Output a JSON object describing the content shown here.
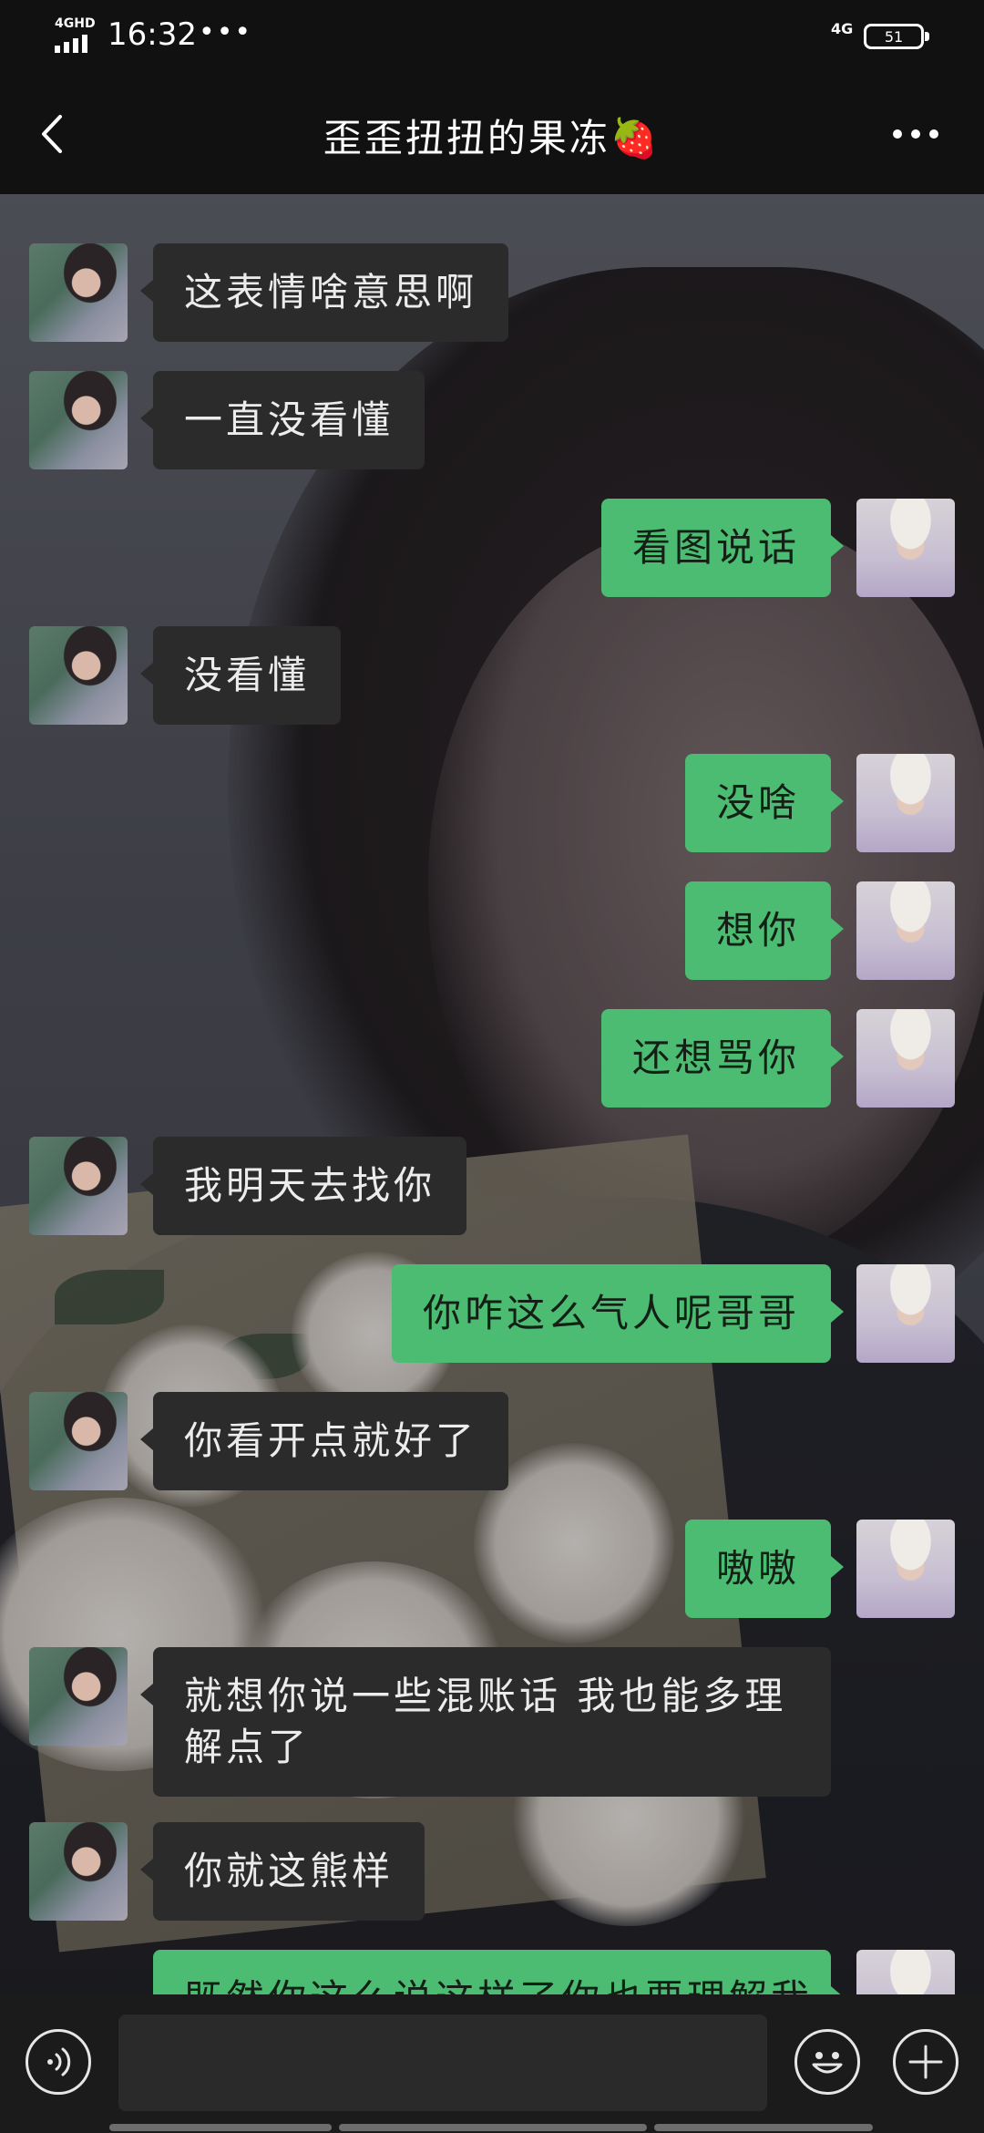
{
  "status_bar": {
    "network_label": "4GHD",
    "time": "16:32",
    "more_dots": "•••",
    "data_label": "4G",
    "battery": "51"
  },
  "header": {
    "title": "歪歪扭扭的果冻🍓"
  },
  "messages": [
    {
      "from": "them",
      "text": "这表情啥意思啊"
    },
    {
      "from": "them",
      "text": "一直没看懂"
    },
    {
      "from": "me",
      "text": "看图说话"
    },
    {
      "from": "them",
      "text": "没看懂"
    },
    {
      "from": "me",
      "text": "没啥"
    },
    {
      "from": "me",
      "text": "想你"
    },
    {
      "from": "me",
      "text": "还想骂你"
    },
    {
      "from": "them",
      "text": "我明天去找你"
    },
    {
      "from": "me",
      "text": "你咋这么气人呢哥哥"
    },
    {
      "from": "them",
      "text": "你看开点就好了"
    },
    {
      "from": "me",
      "text": "嗷嗷"
    },
    {
      "from": "them",
      "text": "就想你说一些混账话 我也能多理解点了"
    },
    {
      "from": "them",
      "text": "你就这熊样"
    },
    {
      "from": "me",
      "text": "既然你这么说这样了你也要理解我"
    }
  ],
  "input_bar": {
    "placeholder": "",
    "value": ""
  },
  "colors": {
    "my_bubble": "#4cbc72",
    "their_bubble": "#2b2b2b",
    "bar_background": "#111111"
  },
  "icons": [
    "back-arrow-icon",
    "more-icon",
    "voice-icon",
    "emoji-icon",
    "plus-icon"
  ]
}
